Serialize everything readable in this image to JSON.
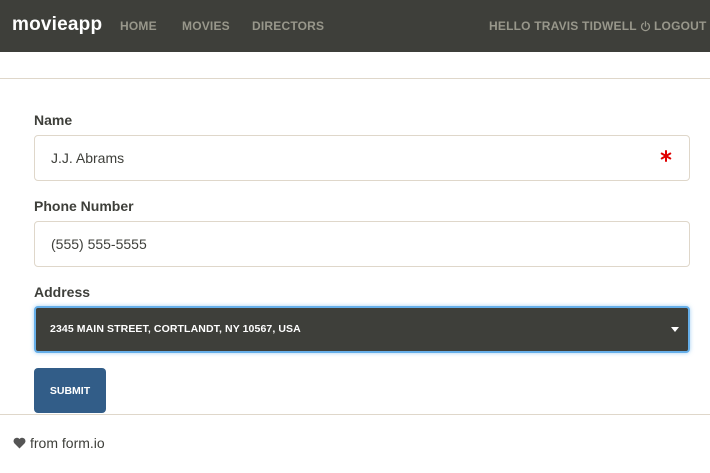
{
  "navbar": {
    "brand": "movieapp",
    "links": [
      "HOME",
      "MOVIES",
      "DIRECTORS"
    ],
    "user_greeting": "HELLO TRAVIS TIDWELL",
    "logout_label": "LOGOUT",
    "logout_icon": "power-icon",
    "background": "#3e3f3a"
  },
  "form": {
    "name": {
      "label": "Name",
      "value": "J.J. Abrams",
      "required_icon": "asterisk-icon",
      "required_color": "#e00000"
    },
    "phone": {
      "label": "Phone Number",
      "value": "(555) 555-5555"
    },
    "address": {
      "label": "Address",
      "value": "2345 MAIN STREET, CORTLANDT, NY 10567, USA",
      "caret_icon": "chevron-down-icon"
    },
    "submit_label": "SUBMIT",
    "submit_color": "#325d88"
  },
  "footer": {
    "icon": "heart-icon",
    "text": "from form.io"
  }
}
